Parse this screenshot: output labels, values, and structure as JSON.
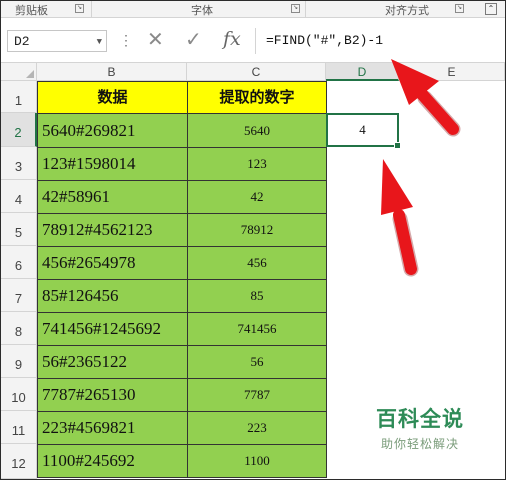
{
  "ribbon": {
    "groups": [
      "剪贴板",
      "字体",
      "对齐方式"
    ]
  },
  "formula_bar": {
    "name_box": "D2",
    "cancel_glyph": "✕",
    "enter_glyph": "✓",
    "fx_label": "fx",
    "formula": "=FIND(\"#\",B2)-1"
  },
  "columns": [
    "B",
    "C",
    "D",
    "E"
  ],
  "row_numbers": [
    "1",
    "2",
    "3",
    "4",
    "5",
    "6",
    "7",
    "8",
    "9",
    "10",
    "11",
    "12"
  ],
  "table": {
    "header_b": "数据",
    "header_c": "提取的数字",
    "rows": [
      {
        "b": "5640#269821",
        "c": "5640"
      },
      {
        "b": "123#1598014",
        "c": "123"
      },
      {
        "b": "42#58961",
        "c": "42"
      },
      {
        "b": "78912#4562123",
        "c": "78912"
      },
      {
        "b": "456#2654978",
        "c": "456"
      },
      {
        "b": "85#126456",
        "c": "85"
      },
      {
        "b": "741456#1245692",
        "c": "741456"
      },
      {
        "b": "56#2365122",
        "c": "56"
      },
      {
        "b": "7787#265130",
        "c": "7787"
      },
      {
        "b": "223#4569821",
        "c": "223"
      },
      {
        "b": "1100#245692",
        "c": "1100"
      }
    ]
  },
  "active_cell_value": "4",
  "watermark": {
    "title": "百科全说",
    "subtitle": "助你轻松解决"
  },
  "colors": {
    "header_fill": "#ffff00",
    "data_fill": "#92d050",
    "arrow_red": "#e8161b",
    "selection_green": "#217346"
  },
  "icons": [
    "cancel-icon",
    "enter-icon",
    "fx-icon",
    "arrow-to-formula-icon",
    "arrow-to-cell-icon"
  ]
}
